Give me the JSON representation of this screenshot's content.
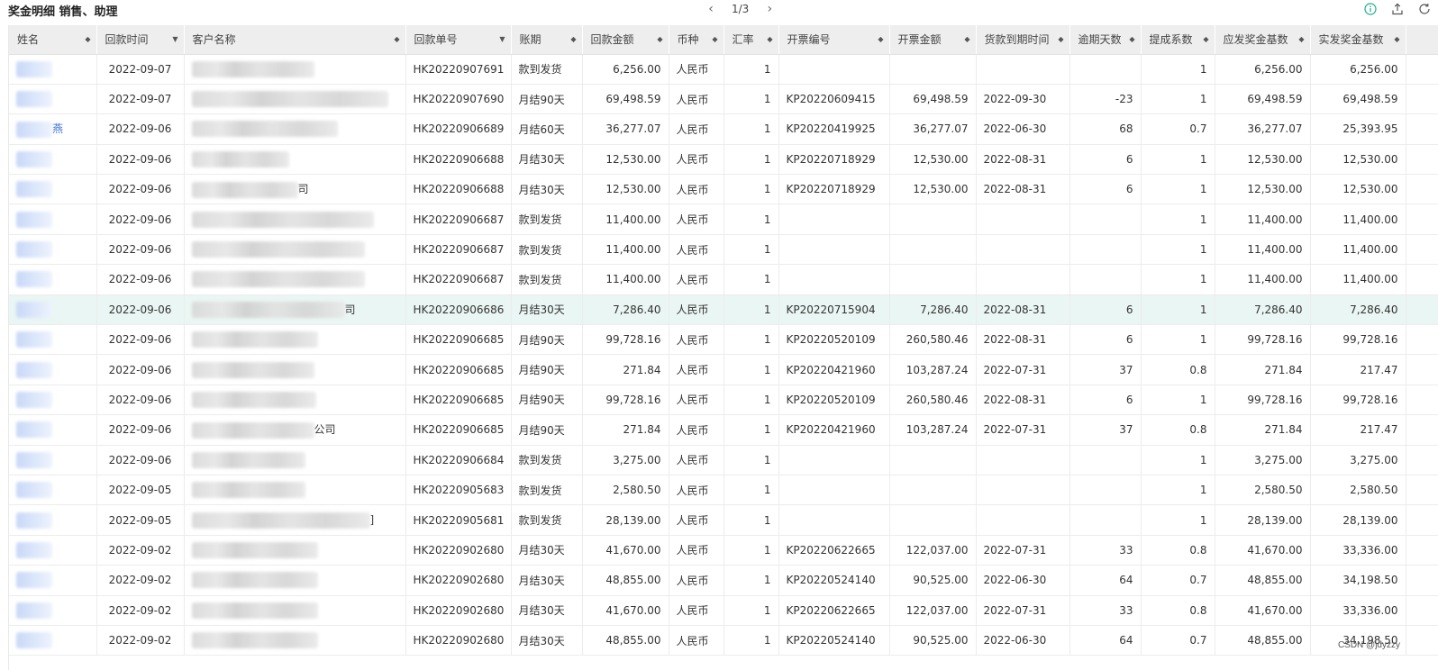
{
  "header": {
    "title": "奖金明细 销售、助理",
    "pager": {
      "prev": "‹",
      "page": "1/3",
      "next": "›"
    }
  },
  "table": {
    "columns": [
      "姓名",
      "回款时间",
      "客户名称",
      "回款单号",
      "账期",
      "回款金额",
      "币种",
      "汇率",
      "开票编号",
      "开票金额",
      "货款到期时间",
      "逾期天数",
      "提成系数",
      "应发奖金基数",
      "实发奖金基数"
    ],
    "rows": [
      {
        "suffix": "",
        "date": "2022-09-07",
        "cust_suffix": "",
        "hk": "HK20220907691",
        "term": "款到发货",
        "amt": "6,256.00",
        "cur": "人民币",
        "rate": "1",
        "inv": "",
        "invamt": "",
        "due": "",
        "over": "",
        "coef": "1",
        "base": "6,256.00",
        "act": "6,256.00"
      },
      {
        "suffix": "",
        "date": "2022-09-07",
        "cust_suffix": "",
        "hk": "HK20220907690",
        "term": "月结90天",
        "amt": "69,498.59",
        "cur": "人民币",
        "rate": "1",
        "inv": "KP20220609415",
        "invamt": "69,498.59",
        "due": "2022-09-30",
        "over": "-23",
        "coef": "1",
        "base": "69,498.59",
        "act": "69,498.59"
      },
      {
        "suffix": "燕",
        "date": "2022-09-06",
        "cust_suffix": "",
        "hk": "HK20220906689",
        "term": "月结60天",
        "amt": "36,277.07",
        "cur": "人民币",
        "rate": "1",
        "inv": "KP20220419925",
        "invamt": "36,277.07",
        "due": "2022-06-30",
        "over": "68",
        "coef": "0.7",
        "base": "36,277.07",
        "act": "25,393.95"
      },
      {
        "suffix": "",
        "date": "2022-09-06",
        "cust_suffix": "",
        "hk": "HK20220906688",
        "term": "月结30天",
        "amt": "12,530.00",
        "cur": "人民币",
        "rate": "1",
        "inv": "KP20220718929",
        "invamt": "12,530.00",
        "due": "2022-08-31",
        "over": "6",
        "coef": "1",
        "base": "12,530.00",
        "act": "12,530.00"
      },
      {
        "suffix": "",
        "date": "2022-09-06",
        "cust_suffix": "司",
        "hk": "HK20220906688",
        "term": "月结30天",
        "amt": "12,530.00",
        "cur": "人民币",
        "rate": "1",
        "inv": "KP20220718929",
        "invamt": "12,530.00",
        "due": "2022-08-31",
        "over": "6",
        "coef": "1",
        "base": "12,530.00",
        "act": "12,530.00"
      },
      {
        "suffix": "",
        "date": "2022-09-06",
        "cust_suffix": "",
        "hk": "HK20220906687",
        "term": "款到发货",
        "amt": "11,400.00",
        "cur": "人民币",
        "rate": "1",
        "inv": "",
        "invamt": "",
        "due": "",
        "over": "",
        "coef": "1",
        "base": "11,400.00",
        "act": "11,400.00"
      },
      {
        "suffix": "",
        "date": "2022-09-06",
        "cust_suffix": "",
        "hk": "HK20220906687",
        "term": "款到发货",
        "amt": "11,400.00",
        "cur": "人民币",
        "rate": "1",
        "inv": "",
        "invamt": "",
        "due": "",
        "over": "",
        "coef": "1",
        "base": "11,400.00",
        "act": "11,400.00"
      },
      {
        "suffix": "",
        "date": "2022-09-06",
        "cust_suffix": "",
        "hk": "HK20220906687",
        "term": "款到发货",
        "amt": "11,400.00",
        "cur": "人民币",
        "rate": "1",
        "inv": "",
        "invamt": "",
        "due": "",
        "over": "",
        "coef": "1",
        "base": "11,400.00",
        "act": "11,400.00"
      },
      {
        "suffix": "",
        "date": "2022-09-06",
        "cust_suffix": "司",
        "hk": "HK20220906686",
        "term": "月结30天",
        "amt": "7,286.40",
        "cur": "人民币",
        "rate": "1",
        "inv": "KP20220715904",
        "invamt": "7,286.40",
        "due": "2022-08-31",
        "over": "6",
        "coef": "1",
        "base": "7,286.40",
        "act": "7,286.40",
        "highlight": true
      },
      {
        "suffix": "",
        "date": "2022-09-06",
        "cust_suffix": "",
        "hk": "HK20220906685",
        "term": "月结90天",
        "amt": "99,728.16",
        "cur": "人民币",
        "rate": "1",
        "inv": "KP20220520109",
        "invamt": "260,580.46",
        "due": "2022-08-31",
        "over": "6",
        "coef": "1",
        "base": "99,728.16",
        "act": "99,728.16"
      },
      {
        "suffix": "",
        "date": "2022-09-06",
        "cust_suffix": "",
        "hk": "HK20220906685",
        "term": "月结90天",
        "amt": "271.84",
        "cur": "人民币",
        "rate": "1",
        "inv": "KP20220421960",
        "invamt": "103,287.24",
        "due": "2022-07-31",
        "over": "37",
        "coef": "0.8",
        "base": "271.84",
        "act": "217.47"
      },
      {
        "suffix": "",
        "date": "2022-09-06",
        "cust_suffix": "",
        "hk": "HK20220906685",
        "term": "月结90天",
        "amt": "99,728.16",
        "cur": "人民币",
        "rate": "1",
        "inv": "KP20220520109",
        "invamt": "260,580.46",
        "due": "2022-08-31",
        "over": "6",
        "coef": "1",
        "base": "99,728.16",
        "act": "99,728.16"
      },
      {
        "suffix": "",
        "date": "2022-09-06",
        "cust_suffix": "公司",
        "hk": "HK20220906685",
        "term": "月结90天",
        "amt": "271.84",
        "cur": "人民币",
        "rate": "1",
        "inv": "KP20220421960",
        "invamt": "103,287.24",
        "due": "2022-07-31",
        "over": "37",
        "coef": "0.8",
        "base": "271.84",
        "act": "217.47"
      },
      {
        "suffix": "",
        "date": "2022-09-06",
        "cust_suffix": "",
        "hk": "HK20220906684",
        "term": "款到发货",
        "amt": "3,275.00",
        "cur": "人民币",
        "rate": "1",
        "inv": "",
        "invamt": "",
        "due": "",
        "over": "",
        "coef": "1",
        "base": "3,275.00",
        "act": "3,275.00"
      },
      {
        "suffix": "",
        "date": "2022-09-05",
        "cust_suffix": "",
        "hk": "HK20220905683",
        "term": "款到发货",
        "amt": "2,580.50",
        "cur": "人民币",
        "rate": "1",
        "inv": "",
        "invamt": "",
        "due": "",
        "over": "",
        "coef": "1",
        "base": "2,580.50",
        "act": "2,580.50"
      },
      {
        "suffix": "",
        "date": "2022-09-05",
        "cust_suffix": "]",
        "hk": "HK20220905681",
        "term": "款到发货",
        "amt": "28,139.00",
        "cur": "人民币",
        "rate": "1",
        "inv": "",
        "invamt": "",
        "due": "",
        "over": "",
        "coef": "1",
        "base": "28,139.00",
        "act": "28,139.00"
      },
      {
        "suffix": "",
        "date": "2022-09-02",
        "cust_suffix": "",
        "hk": "HK20220902680",
        "term": "月结30天",
        "amt": "41,670.00",
        "cur": "人民币",
        "rate": "1",
        "inv": "KP20220622665",
        "invamt": "122,037.00",
        "due": "2022-07-31",
        "over": "33",
        "coef": "0.8",
        "base": "41,670.00",
        "act": "33,336.00"
      },
      {
        "suffix": "",
        "date": "2022-09-02",
        "cust_suffix": "",
        "hk": "HK20220902680",
        "term": "月结30天",
        "amt": "48,855.00",
        "cur": "人民币",
        "rate": "1",
        "inv": "KP20220524140",
        "invamt": "90,525.00",
        "due": "2022-06-30",
        "over": "64",
        "coef": "0.7",
        "base": "48,855.00",
        "act": "34,198.50"
      },
      {
        "suffix": "",
        "date": "2022-09-02",
        "cust_suffix": "",
        "hk": "HK20220902680",
        "term": "月结30天",
        "amt": "41,670.00",
        "cur": "人民币",
        "rate": "1",
        "inv": "KP20220622665",
        "invamt": "122,037.00",
        "due": "2022-07-31",
        "over": "33",
        "coef": "0.8",
        "base": "41,670.00",
        "act": "33,336.00"
      },
      {
        "suffix": "",
        "date": "2022-09-02",
        "cust_suffix": "",
        "hk": "HK20220902680",
        "term": "月结30天",
        "amt": "48,855.00",
        "cur": "人民币",
        "rate": "1",
        "inv": "KP20220524140",
        "invamt": "90,525.00",
        "due": "2022-06-30",
        "over": "64",
        "coef": "0.7",
        "base": "48,855.00",
        "act": "34,198.50"
      }
    ]
  },
  "watermark": "CSDN @jdyzzy",
  "icons": {
    "info": "info-icon",
    "export": "export-icon",
    "refresh": "refresh-icon",
    "sort": "sort-icon"
  },
  "colors": {
    "accent": "#1aad8c",
    "header_bg": "#eeeeee",
    "highlight_row": "#eaf6f3"
  }
}
